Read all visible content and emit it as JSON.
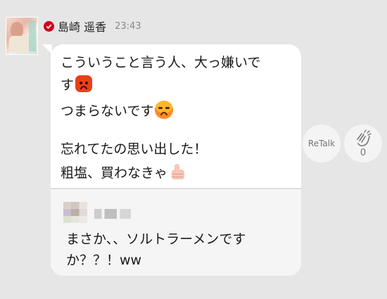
{
  "post": {
    "author": "島崎 遥香",
    "time": "23:43",
    "lines": [
      "こういうこと言う人、大っ嫌いで",
      "す",
      "つまらないです",
      "忘れてたの思い出した！",
      "粗塩、買わなきゃ"
    ],
    "emojis": [
      "angry-face-icon",
      "meh-face-icon",
      "thumbs-up-icon"
    ]
  },
  "quote": {
    "text_line1": "まさか、、ソルトラーメンです",
    "text_line2": "か？？！ww"
  },
  "actions": {
    "retalk_label": "ReTalk",
    "clap_count": "0"
  },
  "colors": {
    "background": "#e6e6e6",
    "bubble": "#ffffff",
    "quote_background": "#f5f5f5",
    "verified_badge": "#d0021b"
  }
}
